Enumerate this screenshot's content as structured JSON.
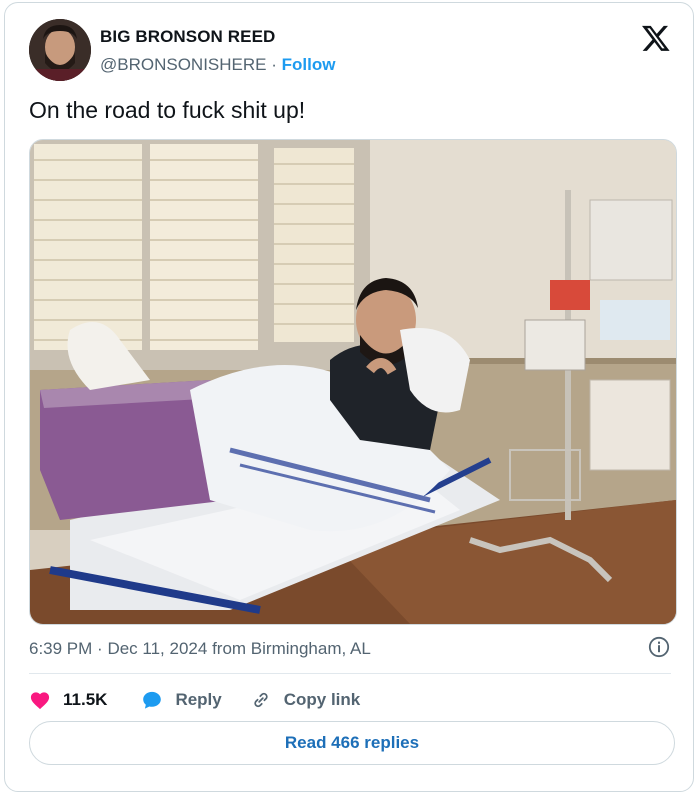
{
  "author": {
    "name": "BIG BRONSON REED",
    "handle": "@BRONSONISHERE",
    "separator": "·",
    "follow_label": "Follow"
  },
  "tweet": {
    "text": "On the road to fuck shit up!",
    "time": "6:39 PM",
    "date": "Dec 11, 2024",
    "location": "from Birmingham, AL",
    "meta_separator": "·"
  },
  "actions": {
    "likes_count": "11.5K",
    "reply_label": "Reply",
    "copy_link_label": "Copy link",
    "read_replies_label": "Read 466 replies"
  },
  "icons": {
    "platform": "x-logo-icon",
    "info": "info-icon",
    "like": "heart-icon",
    "reply": "reply-bubble-icon",
    "copy": "link-icon"
  },
  "colors": {
    "like": "#f91880",
    "reply_icon": "#1d9bf0",
    "follow": "#1d9bf0",
    "read_replies": "#1d6fb8"
  }
}
